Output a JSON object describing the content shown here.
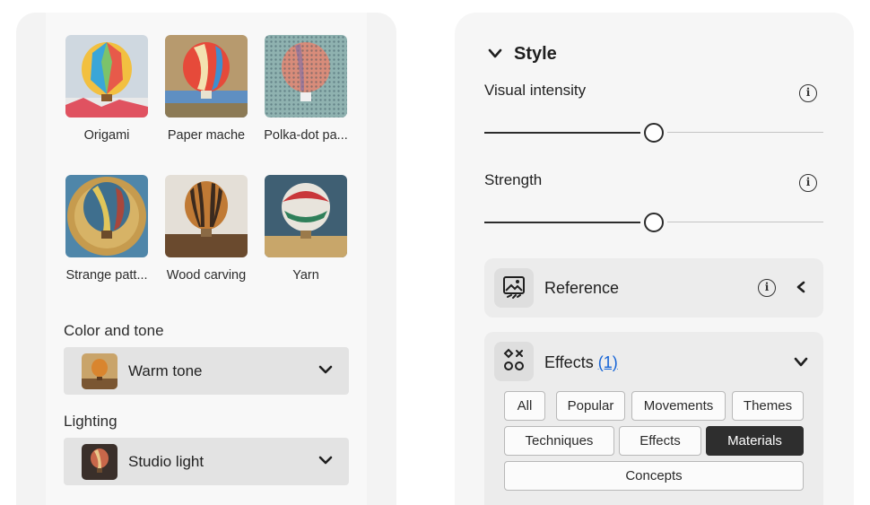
{
  "left": {
    "thumbnails": [
      {
        "label": "Origami"
      },
      {
        "label": "Paper mache"
      },
      {
        "label": "Polka-dot pa..."
      },
      {
        "label": "Strange patt..."
      },
      {
        "label": "Wood carving"
      },
      {
        "label": "Yarn"
      }
    ],
    "color_tone": {
      "label": "Color and tone",
      "value": "Warm tone"
    },
    "lighting": {
      "label": "Lighting",
      "value": "Studio light"
    }
  },
  "right": {
    "section_title": "Style",
    "sliders": [
      {
        "label": "Visual intensity",
        "value_fraction": 0.5
      },
      {
        "label": "Strength",
        "value_fraction": 0.5
      }
    ],
    "reference": {
      "title": "Reference",
      "icon": "image-reference-icon"
    },
    "effects": {
      "title": "Effects",
      "count": "(1)",
      "icon": "effects-grid-icon",
      "chips": [
        "All",
        "Popular",
        "Movements",
        "Themes",
        "Techniques",
        "Effects",
        "Materials",
        "Concepts"
      ],
      "selected": "Materials"
    }
  },
  "colors": {
    "accent_link": "#1463d6",
    "chip_selected": "#2e2e2e"
  }
}
